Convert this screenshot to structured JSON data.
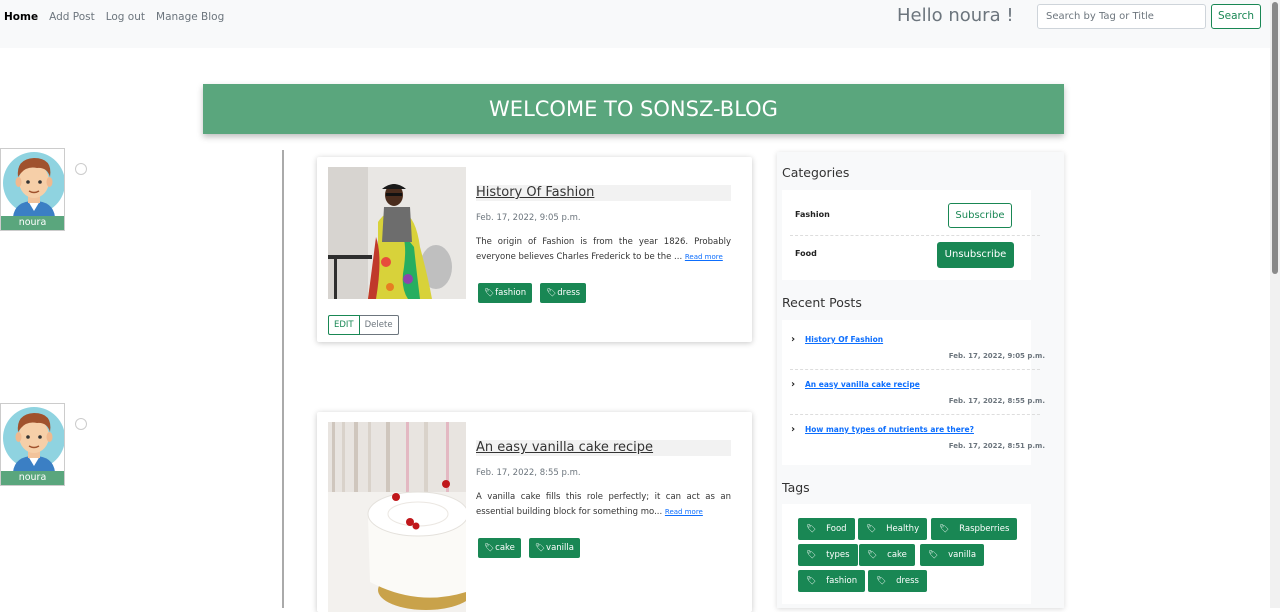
{
  "nav": {
    "links": [
      "Home",
      "Add Post",
      "Log out",
      "Manage Blog"
    ],
    "greeting": "Hello noura !",
    "search_placeholder": "Search by Tag or Title",
    "search_button": "Search"
  },
  "banner": {
    "title": "WELCOME TO SONSZ-BLOG"
  },
  "posts": [
    {
      "author": "noura",
      "title": "History Of Fashion",
      "date": "Feb. 17, 2022, 9:05 p.m.",
      "excerpt": "The origin of Fashion is from the year 1826. Probably everyone believes Charles Frederick to be the ...",
      "read_more": "Read more",
      "tags": [
        "fashion",
        "dress"
      ],
      "edit_label": "EDIT",
      "delete_label": "Delete"
    },
    {
      "author": "noura",
      "title": "An easy vanilla cake recipe",
      "date": "Feb. 17, 2022, 8:55 p.m.",
      "excerpt": "A vanilla cake fills this role perfectly; it can act as an essential building block for something mo...",
      "read_more": "Read more",
      "tags": [
        "cake",
        "vanilla"
      ]
    }
  ],
  "sidebar": {
    "categories_heading": "Categories",
    "categories": [
      {
        "name": "Fashion",
        "action": "Subscribe"
      },
      {
        "name": "Food",
        "action": "Unsubscribe"
      }
    ],
    "recent_heading": "Recent Posts",
    "recent": [
      {
        "title": "History Of Fashion",
        "date": "Feb. 17, 2022, 9:05 p.m."
      },
      {
        "title": " An easy vanilla cake recipe",
        "date": "Feb. 17, 2022, 8:55 p.m."
      },
      {
        "title": "How many types of nutrients are there?",
        "date": "Feb. 17, 2022, 8:51 p.m."
      }
    ],
    "tags_heading": "Tags",
    "tags": [
      "Food",
      "Healthy",
      "Raspberries",
      "types",
      "cake",
      "vanilla",
      "fashion",
      "dress"
    ]
  },
  "colors": {
    "primary_green": "#198754",
    "banner_green": "#5aa67d",
    "link_blue": "#0d6efd"
  },
  "icons": [
    "tag-icon",
    "chevron-right-icon",
    "user-avatar"
  ]
}
